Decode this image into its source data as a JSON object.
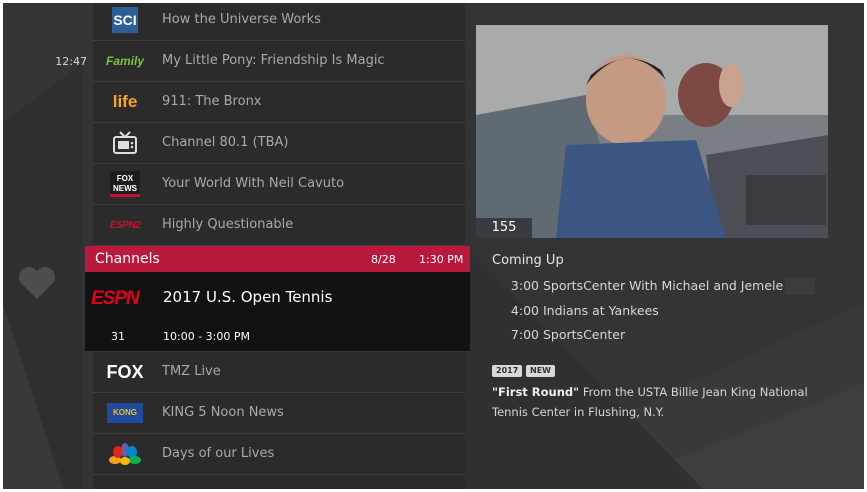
{
  "clock": "12:47",
  "guide": {
    "rows_above": [
      {
        "channel_logo": "science-logo",
        "logo_text": "SCI",
        "title": "How the Universe Works"
      },
      {
        "channel_logo": "discovery-family-logo",
        "logo_text": "Family",
        "title": "My Little Pony: Friendship Is Magic"
      },
      {
        "channel_logo": "discovery-life-logo",
        "logo_text": "life",
        "title": "911: The Bronx"
      },
      {
        "channel_logo": "tv-icon",
        "logo_text": "",
        "title": "Channel 80.1 (TBA)"
      },
      {
        "channel_logo": "fox-news-logo",
        "logo_text": "FOX NEWS",
        "title": "Your World With Neil Cavuto"
      },
      {
        "channel_logo": "espn2-logo",
        "logo_text": "ESPN2",
        "title": "Highly Questionable"
      }
    ],
    "selected": {
      "header_label": "Channels",
      "date": "8/28",
      "time": "1:30 PM",
      "channel_logo": "espn-logo",
      "logo_text": "ESPN",
      "title": "2017 U.S. Open Tennis",
      "channel_number": "31",
      "time_range": "10:00 - 3:00 PM"
    },
    "rows_below": [
      {
        "channel_logo": "fox-logo",
        "logo_text": "FOX",
        "title": "TMZ Live"
      },
      {
        "channel_logo": "king5-logo",
        "logo_text": "KONG",
        "title": "KING 5 Noon News"
      },
      {
        "channel_logo": "nbc-logo",
        "logo_text": "",
        "title": "Days of our Lives"
      }
    ]
  },
  "preview": {
    "channel_number": "155"
  },
  "coming_up": {
    "heading": "Coming Up",
    "items": [
      {
        "time": "3:00",
        "title": "SportsCenter With Michael and Jemele"
      },
      {
        "time": "4:00",
        "title": "Indians at Yankees"
      },
      {
        "time": "7:00",
        "title": "SportsCenter"
      }
    ]
  },
  "details": {
    "year_badge": "2017",
    "new_badge": "NEW",
    "episode_title": "\"First Round\"",
    "description": " From the USTA Billie Jean King National Tennis Center in Flushing, N.Y."
  },
  "colors": {
    "accent": "#b8193c",
    "background": "#333436",
    "row": "#2b2b2c",
    "selected_body": "#121212"
  }
}
